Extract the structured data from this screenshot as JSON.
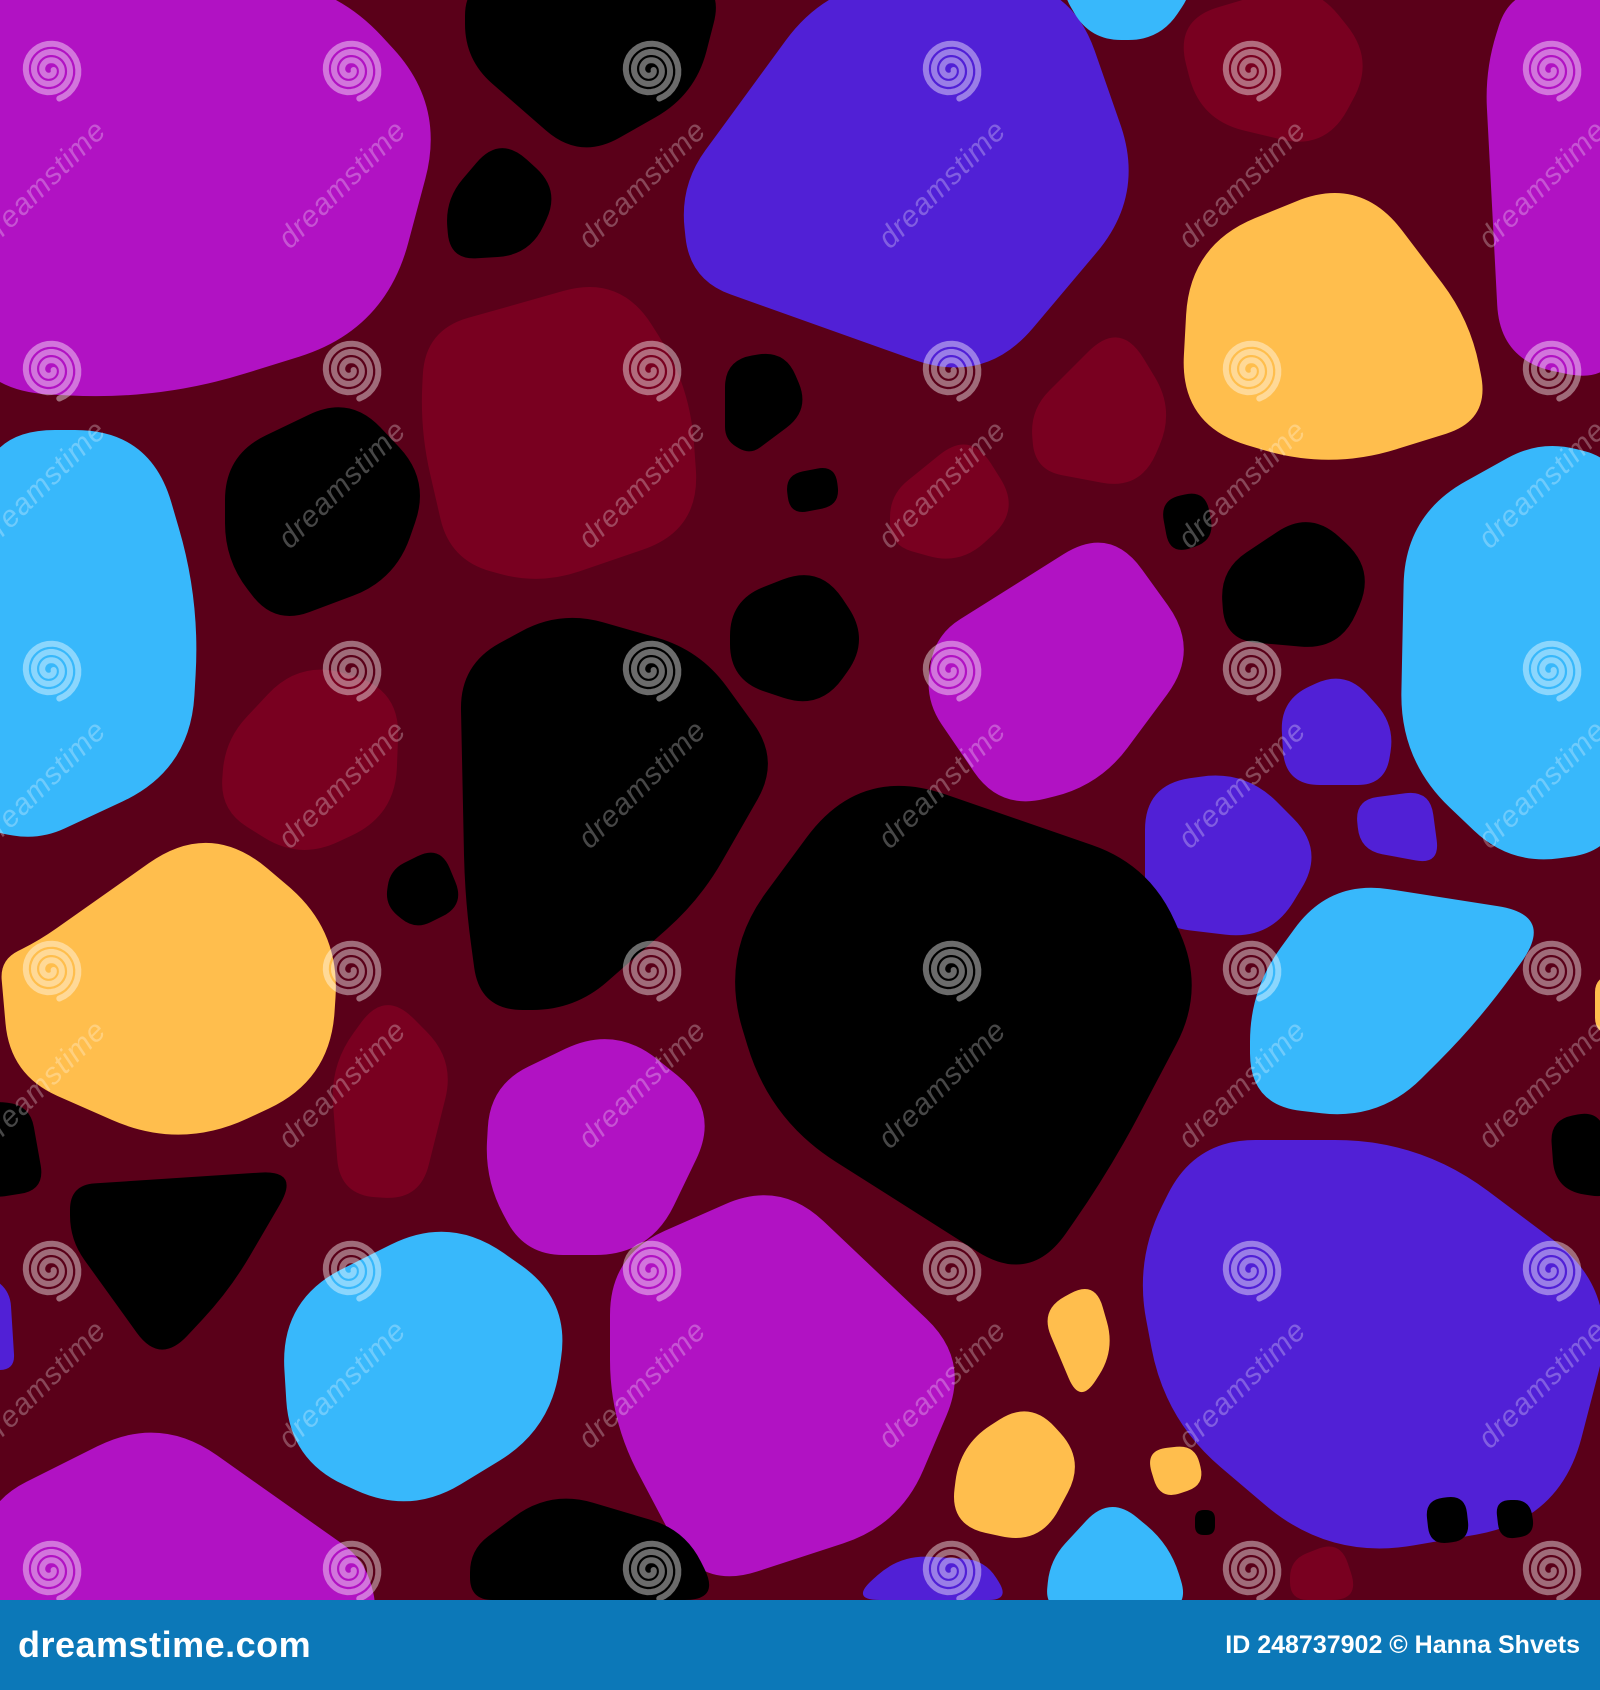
{
  "image": {
    "subject": "seamless pattern of rounded stones",
    "colors": {
      "background": "#5a0019",
      "magenta": "#b112c3",
      "violet": "#5120d6",
      "sky_blue": "#38b8fb",
      "amber": "#ffbe4d",
      "crimson": "#790020",
      "black": "#000000",
      "footer": "#0c78b8"
    }
  },
  "watermark": {
    "text": "dreamstime",
    "icon": "spiral-logo-icon"
  },
  "footer": {
    "brand": "dreamstime.com",
    "credit": "ID 248737902 © Hanna Shvets"
  }
}
